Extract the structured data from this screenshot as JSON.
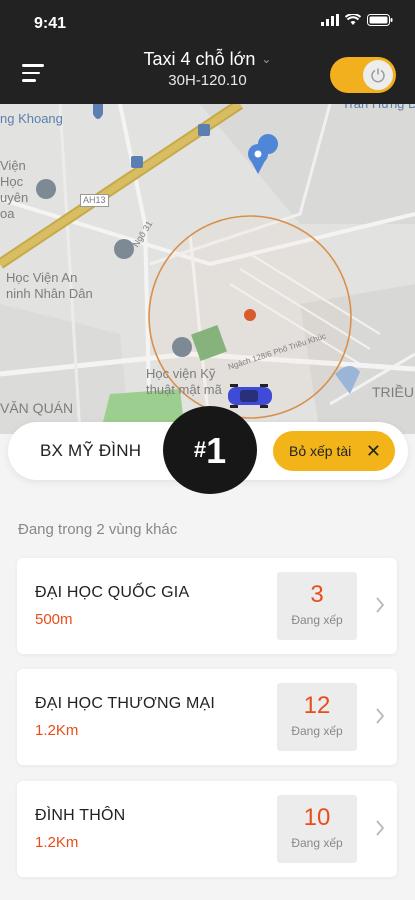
{
  "status": {
    "time": "9:41"
  },
  "header": {
    "vehicle_type": "Taxi 4 chỗ lớn",
    "plate": "30H-120.10",
    "online_toggle": "on"
  },
  "map": {
    "labels": {
      "tran_hung_dao": "Trần Hưng Đạo",
      "ng_khoang": "ng Khoang",
      "vie_1": "Viện",
      "hoc": "Học",
      "uyen": "uyên",
      "oa": "oa",
      "ah13": "AH13",
      "ngo31": "Ngõ 31",
      "hv_an_ninh_1": "Học Viện An",
      "hv_an_ninh_2": "ninh Nhân Dân",
      "hv_ky_thuat_1": "Học viện Kỹ",
      "hv_ky_thuat_2": "thuật mật mã",
      "ngach": "Ngách 128/6 Phố Triều Khúc",
      "van_quan": "VĂN QUÁN",
      "trieu": "TRIỀU"
    }
  },
  "current_zone": {
    "name": "BX MỸ ĐÌNH",
    "rank_hash": "#",
    "rank_number": "1",
    "quit_label": "Bỏ xếp tài"
  },
  "other_zones": {
    "title": "Đang trong 2 vùng khác",
    "queue_label": "Đang xếp",
    "items": [
      {
        "name": "ĐẠI HỌC QUỐC GIA",
        "distance": "500m",
        "queue": "3"
      },
      {
        "name": "ĐẠI HỌC THƯƠNG MẠI",
        "distance": "1.2Km",
        "queue": "12"
      },
      {
        "name": "ĐÌNH THÔN",
        "distance": "1.2Km",
        "queue": "10"
      }
    ]
  },
  "colors": {
    "accent": "#f3b419",
    "distance": "#e84d1c",
    "header_bg": "#222222"
  }
}
